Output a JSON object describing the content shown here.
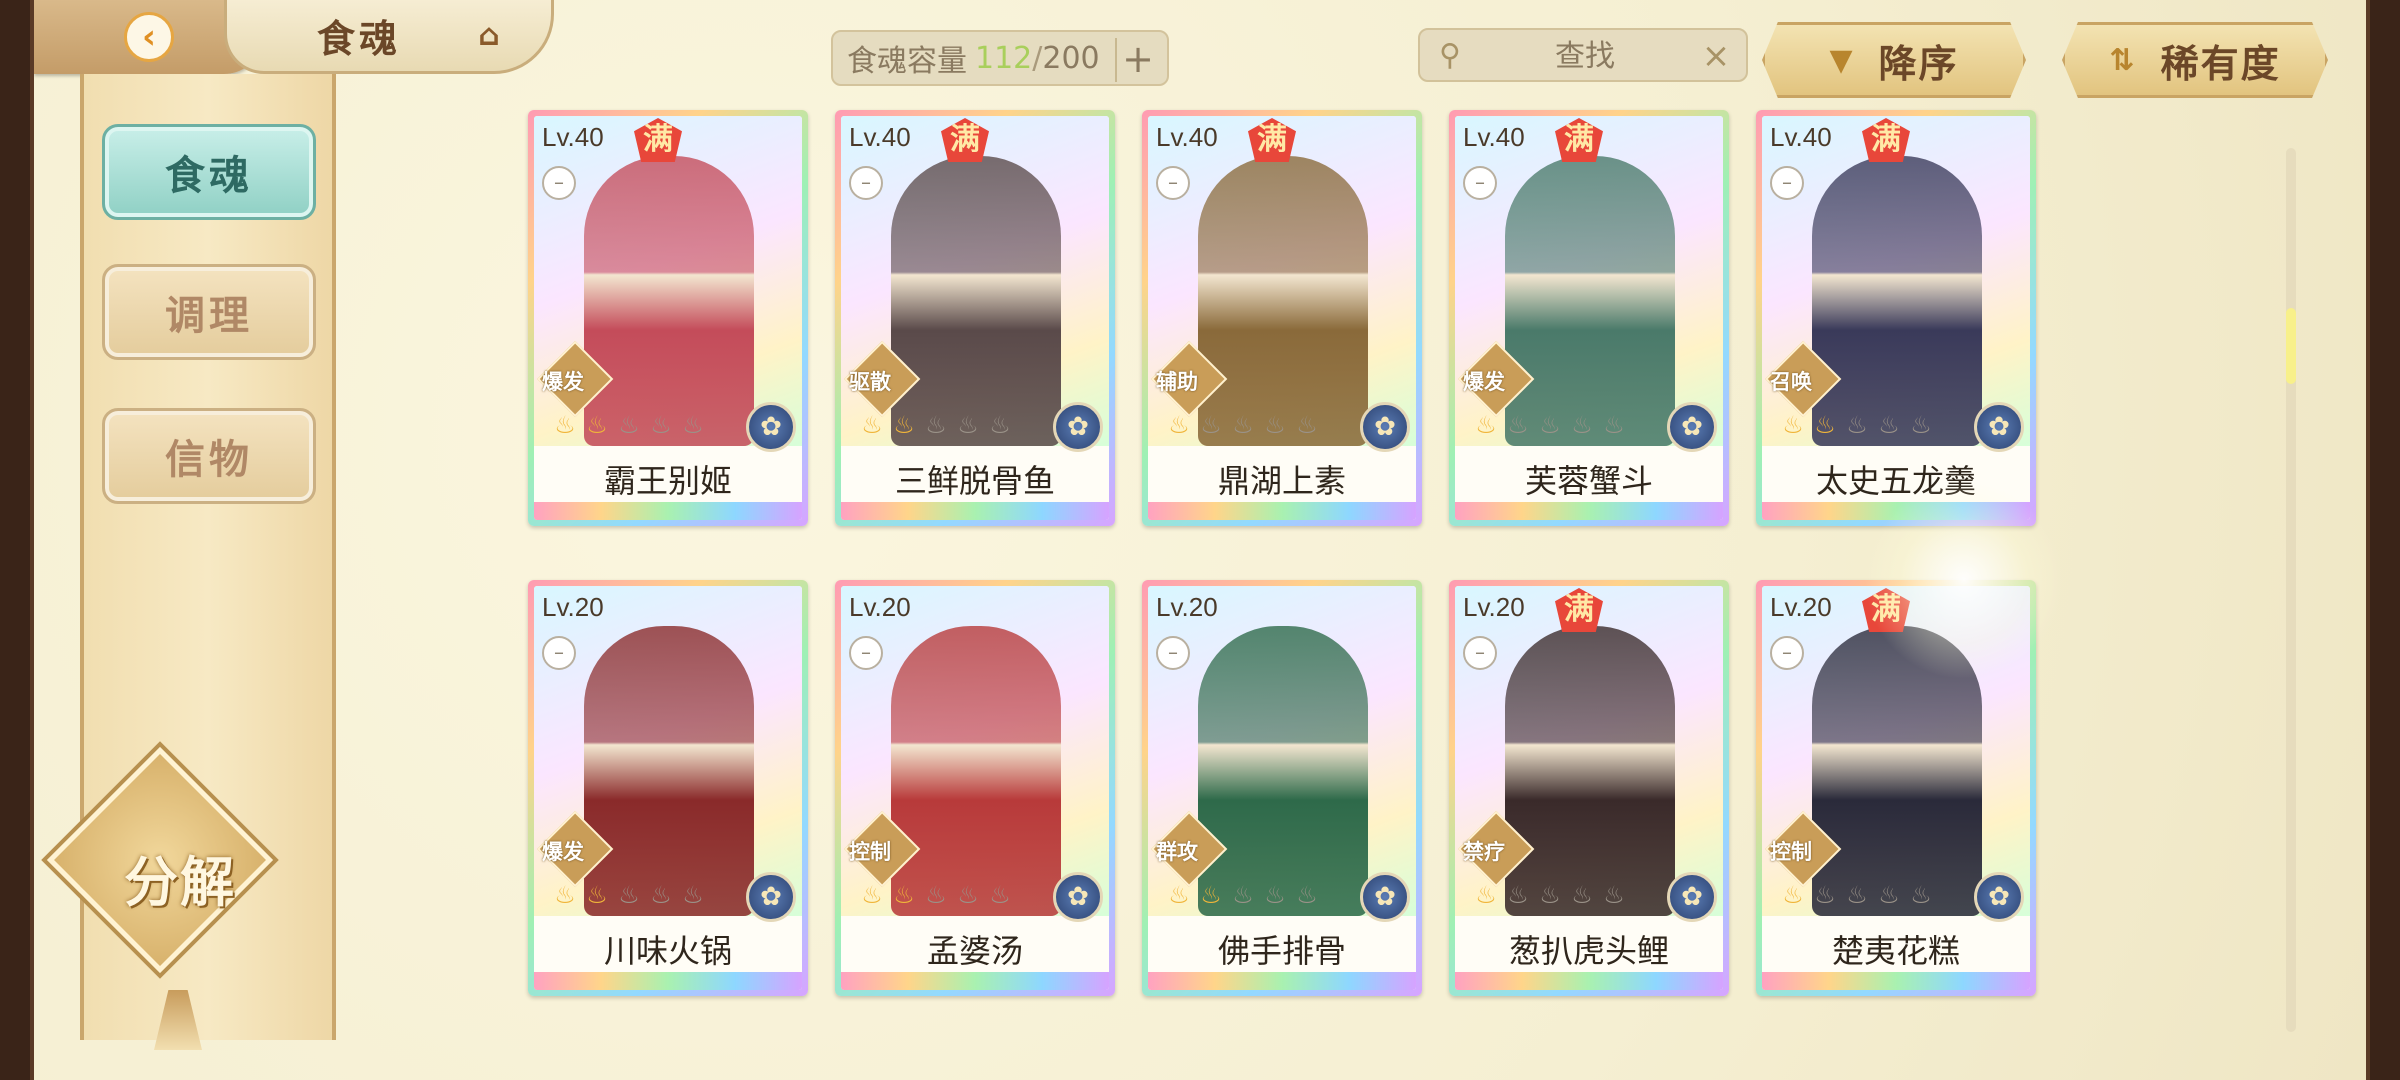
{
  "header": {
    "back_icon": "back-chevron-icon",
    "title": "食魂",
    "home_icon": "pavilion-icon",
    "capacity_label": "食魂容量",
    "capacity_current": "112",
    "capacity_separator": "/",
    "capacity_max": "200",
    "search_placeholder": "查找",
    "sort_order_label": "降序",
    "sort_key_label": "稀有度"
  },
  "sidebar": {
    "items": [
      {
        "label": "食魂",
        "active": true
      },
      {
        "label": "调理",
        "active": false
      },
      {
        "label": "信物",
        "active": false
      }
    ],
    "decompose_label": "分解"
  },
  "cards": [
    {
      "level": "Lv.40",
      "max": "满",
      "role": "爆发",
      "name": "霸王别姬",
      "stars": 2,
      "hue": "#c44c5a"
    },
    {
      "level": "Lv.40",
      "max": "满",
      "role": "驱散",
      "name": "三鲜脱骨鱼",
      "stars": 2,
      "hue": "#5a4a4a"
    },
    {
      "level": "Lv.40",
      "max": "满",
      "role": "辅助",
      "name": "鼎湖上素",
      "stars": 1,
      "hue": "#8a6a3a"
    },
    {
      "level": "Lv.40",
      "max": "满",
      "role": "爆发",
      "name": "芙蓉蟹斗",
      "stars": 1,
      "hue": "#4a7a6a"
    },
    {
      "level": "Lv.40",
      "max": "满",
      "role": "召唤",
      "name": "太史五龙羹",
      "stars": 2,
      "hue": "#3a3a5a"
    },
    {
      "level": "Lv.20",
      "max": "",
      "role": "爆发",
      "name": "川味火锅",
      "stars": 2,
      "hue": "#8a2a2a"
    },
    {
      "level": "Lv.20",
      "max": "",
      "role": "控制",
      "name": "孟婆汤",
      "stars": 2,
      "hue": "#b83a3a"
    },
    {
      "level": "Lv.20",
      "max": "",
      "role": "群攻",
      "name": "佛手排骨",
      "stars": 2,
      "hue": "#2e6a4a"
    },
    {
      "level": "Lv.20",
      "max": "满",
      "role": "禁疗",
      "name": "葱扒虎头鲤",
      "stars": 1,
      "hue": "#3a2a2a"
    },
    {
      "level": "Lv.20",
      "max": "满",
      "role": "控制",
      "name": "楚夷花糕",
      "stars": 1,
      "hue": "#2a2a3a"
    }
  ]
}
